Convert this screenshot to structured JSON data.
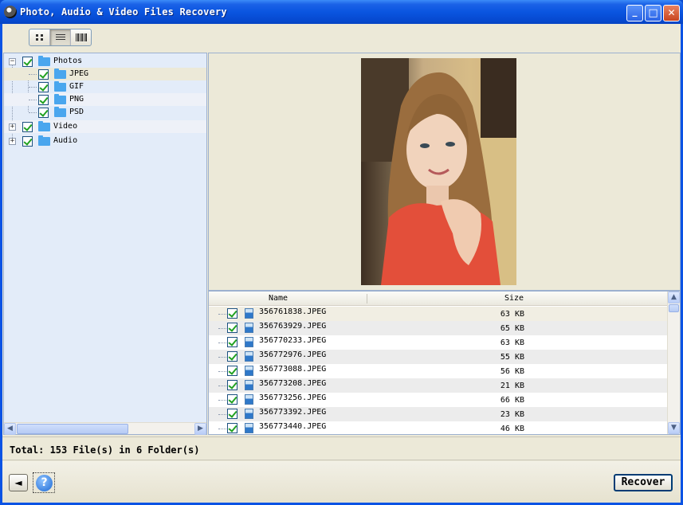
{
  "window": {
    "title": "Photo, Audio & Video Files Recovery",
    "controls": {
      "minimize": "_",
      "maximize": "□",
      "close": "✕"
    }
  },
  "tree": [
    {
      "label": "Photos",
      "expanded": true,
      "checked": true,
      "expander": "−"
    },
    {
      "label": "JPEG",
      "checked": true
    },
    {
      "label": "GIF",
      "checked": true
    },
    {
      "label": "PNG",
      "checked": true
    },
    {
      "label": "PSD",
      "checked": true
    },
    {
      "label": "Video",
      "expanded": false,
      "checked": true,
      "expander": "+"
    },
    {
      "label": "Audio",
      "expanded": false,
      "checked": true,
      "expander": "+"
    }
  ],
  "scroll": {
    "left": "◀",
    "right": "▶",
    "up": "▲",
    "down": "▼"
  },
  "list": {
    "headers": {
      "name": "Name",
      "size": "Size"
    },
    "rows": [
      {
        "name": "356761838.JPEG",
        "size": "63 KB"
      },
      {
        "name": "356763929.JPEG",
        "size": "65 KB"
      },
      {
        "name": "356770233.JPEG",
        "size": "63 KB"
      },
      {
        "name": "356772976.JPEG",
        "size": "55 KB"
      },
      {
        "name": "356773088.JPEG",
        "size": "56 KB"
      },
      {
        "name": "356773208.JPEG",
        "size": "21 KB"
      },
      {
        "name": "356773256.JPEG",
        "size": "66 KB"
      },
      {
        "name": "356773392.JPEG",
        "size": "23 KB"
      },
      {
        "name": "356773440.JPEG",
        "size": "46 KB"
      }
    ]
  },
  "status": "Total: 153 File(s) in 6 Folder(s)",
  "buttons": {
    "back": "◄",
    "help": "?",
    "recover": "Recover"
  }
}
